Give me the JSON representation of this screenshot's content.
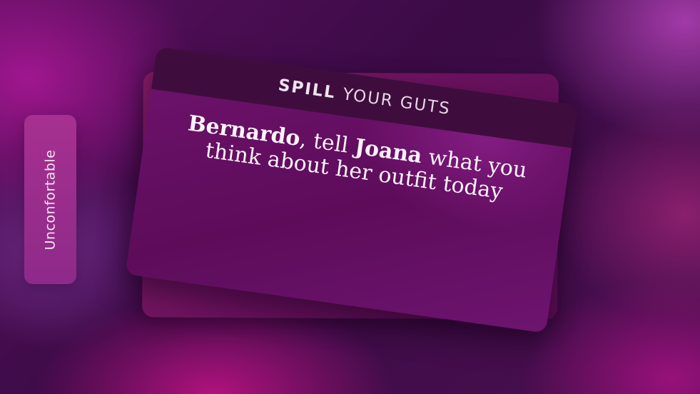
{
  "side_tab": {
    "label": "Unconfortable"
  },
  "card": {
    "category_strong": "SPILL",
    "category_light": "YOUR GUTS",
    "player_one": "Bernardo",
    "text_part1": ", tell ",
    "player_two": "Joana",
    "text_part2": " what you think about her outfit today"
  },
  "colors": {
    "header_bg": "#3e0d3d",
    "card_bg": "#6f136e",
    "pill_bg": "#a6308f"
  }
}
